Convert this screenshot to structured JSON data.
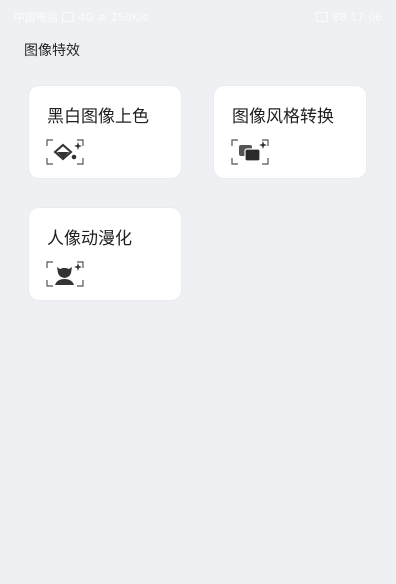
{
  "status_bar": {
    "carrier": "中国电信",
    "network": "4G",
    "speed": "250K/s",
    "battery": "88",
    "time": "17:06"
  },
  "page": {
    "title": "图像特效"
  },
  "cards": [
    {
      "label": "黑白图像上色",
      "icon": "colorize-bucket-icon"
    },
    {
      "label": "图像风格转换",
      "icon": "style-transfer-icon"
    },
    {
      "label": "人像动漫化",
      "icon": "anime-portrait-icon"
    }
  ],
  "colors": {
    "background": "#eef0f3",
    "card": "#ffffff",
    "text": "#1f1f1f",
    "icon": "#333333"
  }
}
